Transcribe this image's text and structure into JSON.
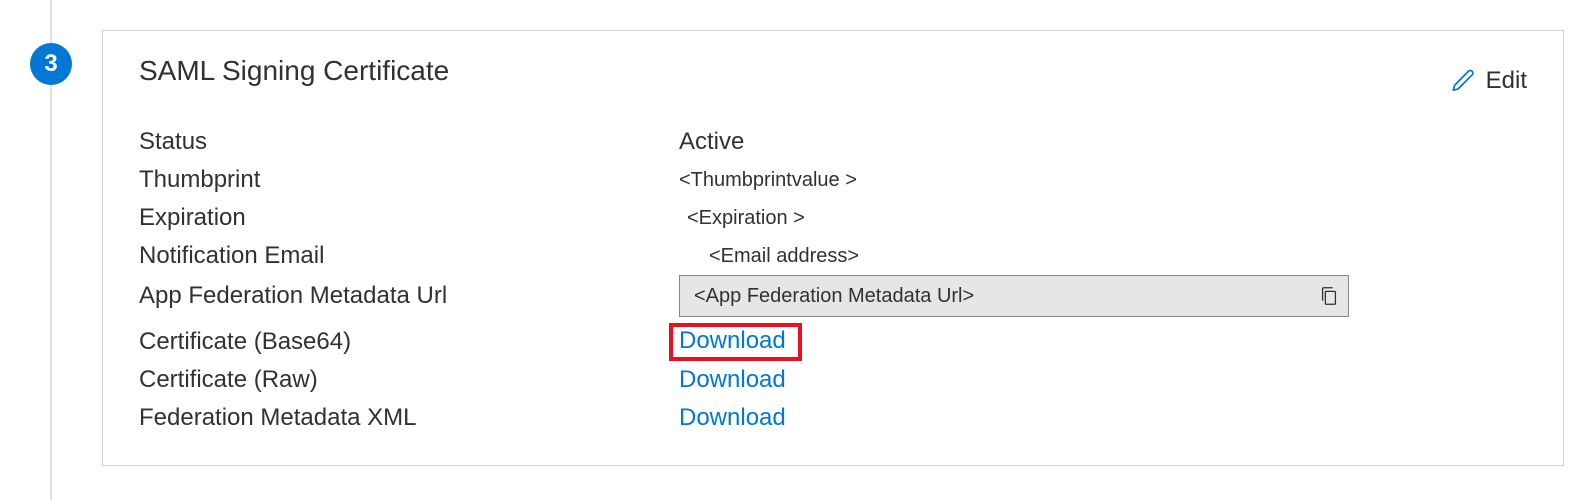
{
  "step_number": "3",
  "card": {
    "title": "SAML Signing Certificate",
    "edit_label": "Edit"
  },
  "fields": {
    "status": {
      "label": "Status",
      "value": "Active"
    },
    "thumbprint": {
      "label": "Thumbprint",
      "value": "<Thumbprintvalue >"
    },
    "expiration": {
      "label": "Expiration",
      "value": "<Expiration >"
    },
    "notification_email": {
      "label": "Notification Email",
      "value": "<Email address>"
    },
    "federation_url": {
      "label": "App Federation Metadata Url",
      "value": "<App Federation  Metadata Url>"
    },
    "cert_base64": {
      "label": "Certificate (Base64)",
      "link": "Download"
    },
    "cert_raw": {
      "label": "Certificate (Raw)",
      "link": "Download"
    },
    "metadata_xml": {
      "label": "Federation Metadata XML",
      "link": "Download"
    }
  }
}
